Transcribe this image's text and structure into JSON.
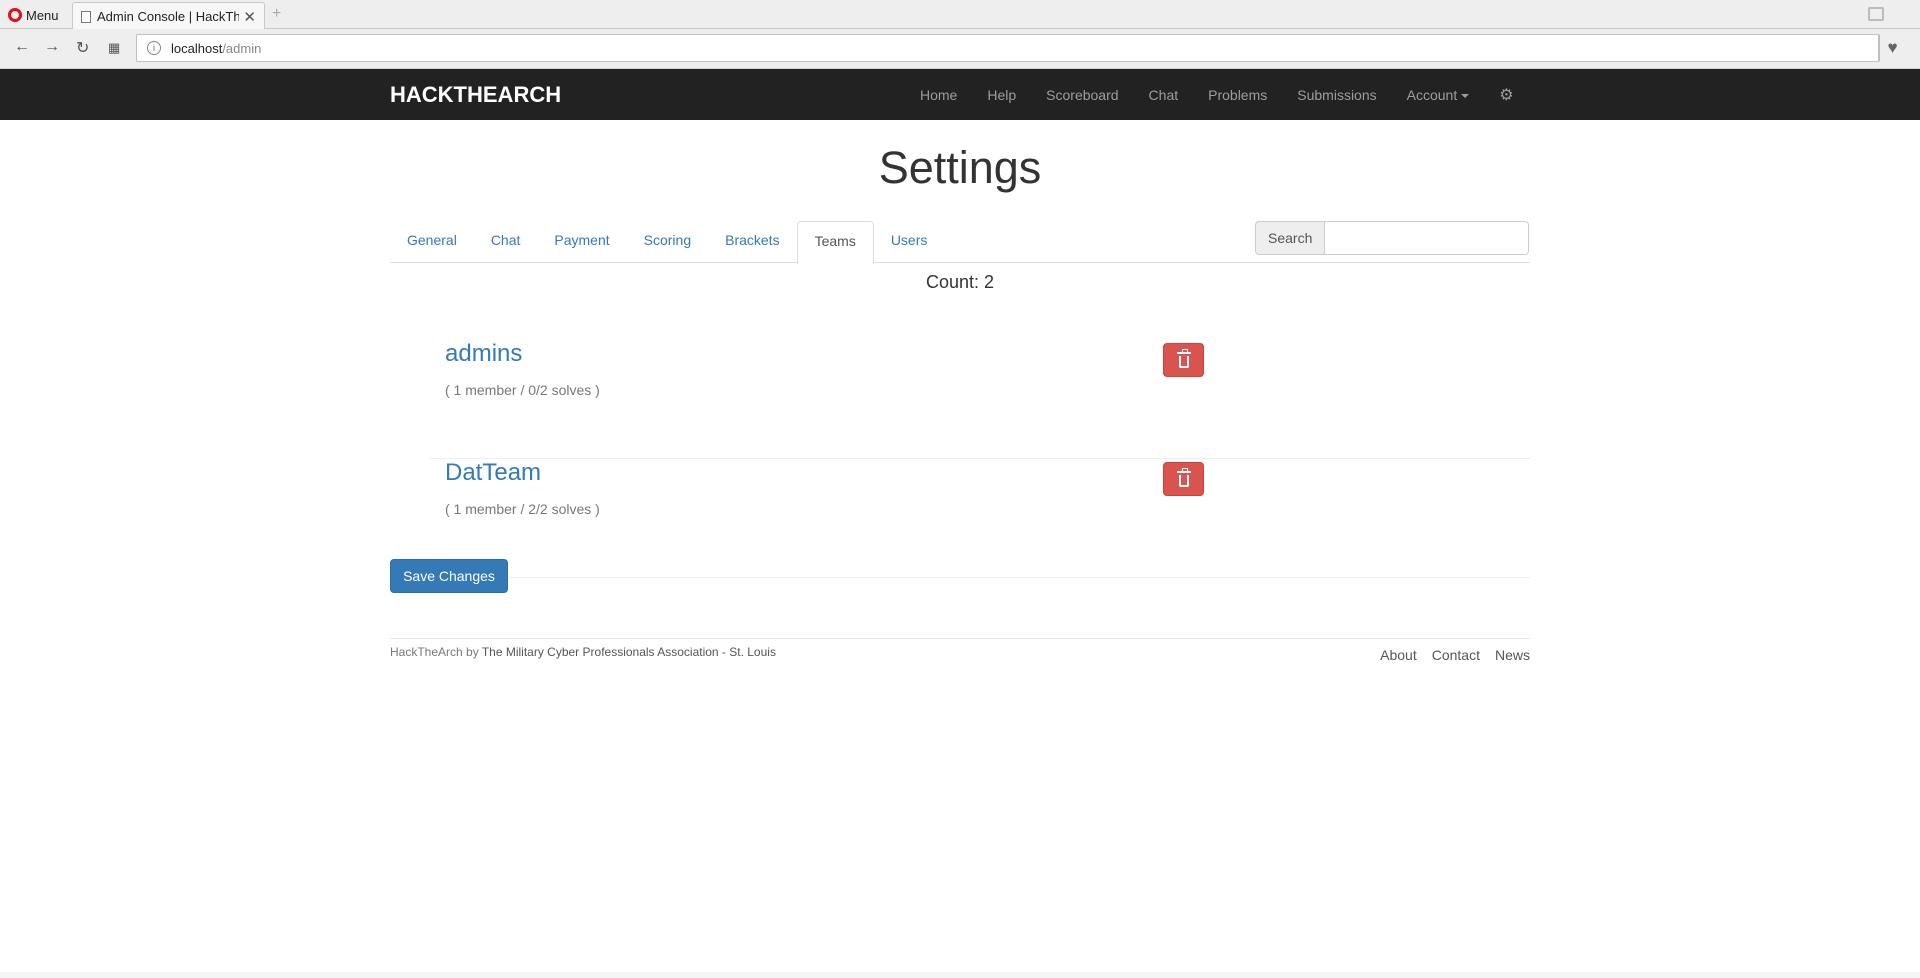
{
  "browser": {
    "menu_label": "Menu",
    "tab_title": "Admin Console | HackTh",
    "tab_close": "✕",
    "new_tab": "+",
    "url_host": "localhost",
    "url_path": "/admin"
  },
  "navbar": {
    "brand": "HACKTHEARCH",
    "items": [
      "Home",
      "Help",
      "Scoreboard",
      "Chat",
      "Problems",
      "Submissions"
    ],
    "account_label": "Account",
    "settings_icon": "gear-icon"
  },
  "page": {
    "title": "Settings",
    "tabs": [
      "General",
      "Chat",
      "Payment",
      "Scoring",
      "Brackets",
      "Teams",
      "Users"
    ],
    "active_tab": "Teams",
    "search_label": "Search",
    "search_value": "",
    "count_text": "Count: 2"
  },
  "teams": [
    {
      "name": "admins",
      "meta": "( 1 member / 0/2 solves )"
    },
    {
      "name": "DatTeam",
      "meta": "( 1 member / 2/2 solves )"
    }
  ],
  "save_label": "Save Changes",
  "footer": {
    "site": "HackTheArch",
    "by": " by ",
    "org": "The Military Cyber Professionals Association - St. Louis",
    "links": [
      "About",
      "Contact",
      "News"
    ]
  },
  "colors": {
    "navbar_bg": "#222222",
    "link": "#337ab7",
    "danger": "#d9534f",
    "primary": "#337ab7"
  }
}
